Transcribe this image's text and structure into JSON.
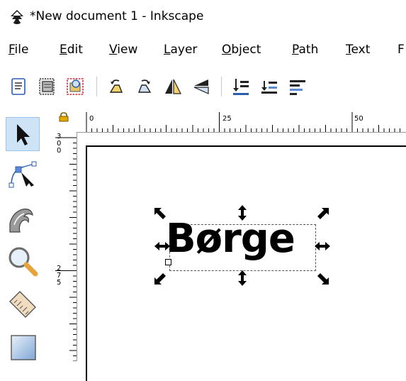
{
  "window": {
    "title": "*New document 1 - Inkscape"
  },
  "menu": [
    {
      "mnemonic": "F",
      "rest": "ile"
    },
    {
      "mnemonic": "E",
      "rest": "dit"
    },
    {
      "mnemonic": "V",
      "rest": "iew"
    },
    {
      "mnemonic": "L",
      "rest": "ayer"
    },
    {
      "mnemonic": "O",
      "rest": "bject"
    },
    {
      "mnemonic": "P",
      "rest": "ath"
    },
    {
      "mnemonic": "T",
      "rest": "ext"
    },
    {
      "mnemonic": "F",
      "rest": ""
    }
  ],
  "toolbar": {
    "buttons": [
      "select-all-icon",
      "select-all-layers-icon",
      "select-same-icon",
      "rotate-ccw-icon",
      "rotate-cw-icon",
      "flip-horizontal-icon",
      "flip-vertical-icon",
      "lower-to-bottom-icon",
      "lower-icon",
      "raise-icon"
    ]
  },
  "tools": [
    {
      "name": "selector-tool-icon",
      "active": true
    },
    {
      "name": "node-tool-icon",
      "active": false
    },
    {
      "name": "tweak-tool-icon",
      "active": false
    },
    {
      "name": "zoom-tool-icon",
      "active": false
    },
    {
      "name": "measure-tool-icon",
      "active": false
    },
    {
      "name": "rectangle-tool-icon",
      "active": false
    }
  ],
  "rulers": {
    "horizontal_labels": [
      "0",
      "25",
      "50"
    ],
    "vertical_labels": [
      "300",
      "275"
    ]
  },
  "canvas": {
    "text_object": "Børge"
  },
  "colors": {
    "selection_bg": "#cfe3f7",
    "accent": "#2a5db0"
  }
}
